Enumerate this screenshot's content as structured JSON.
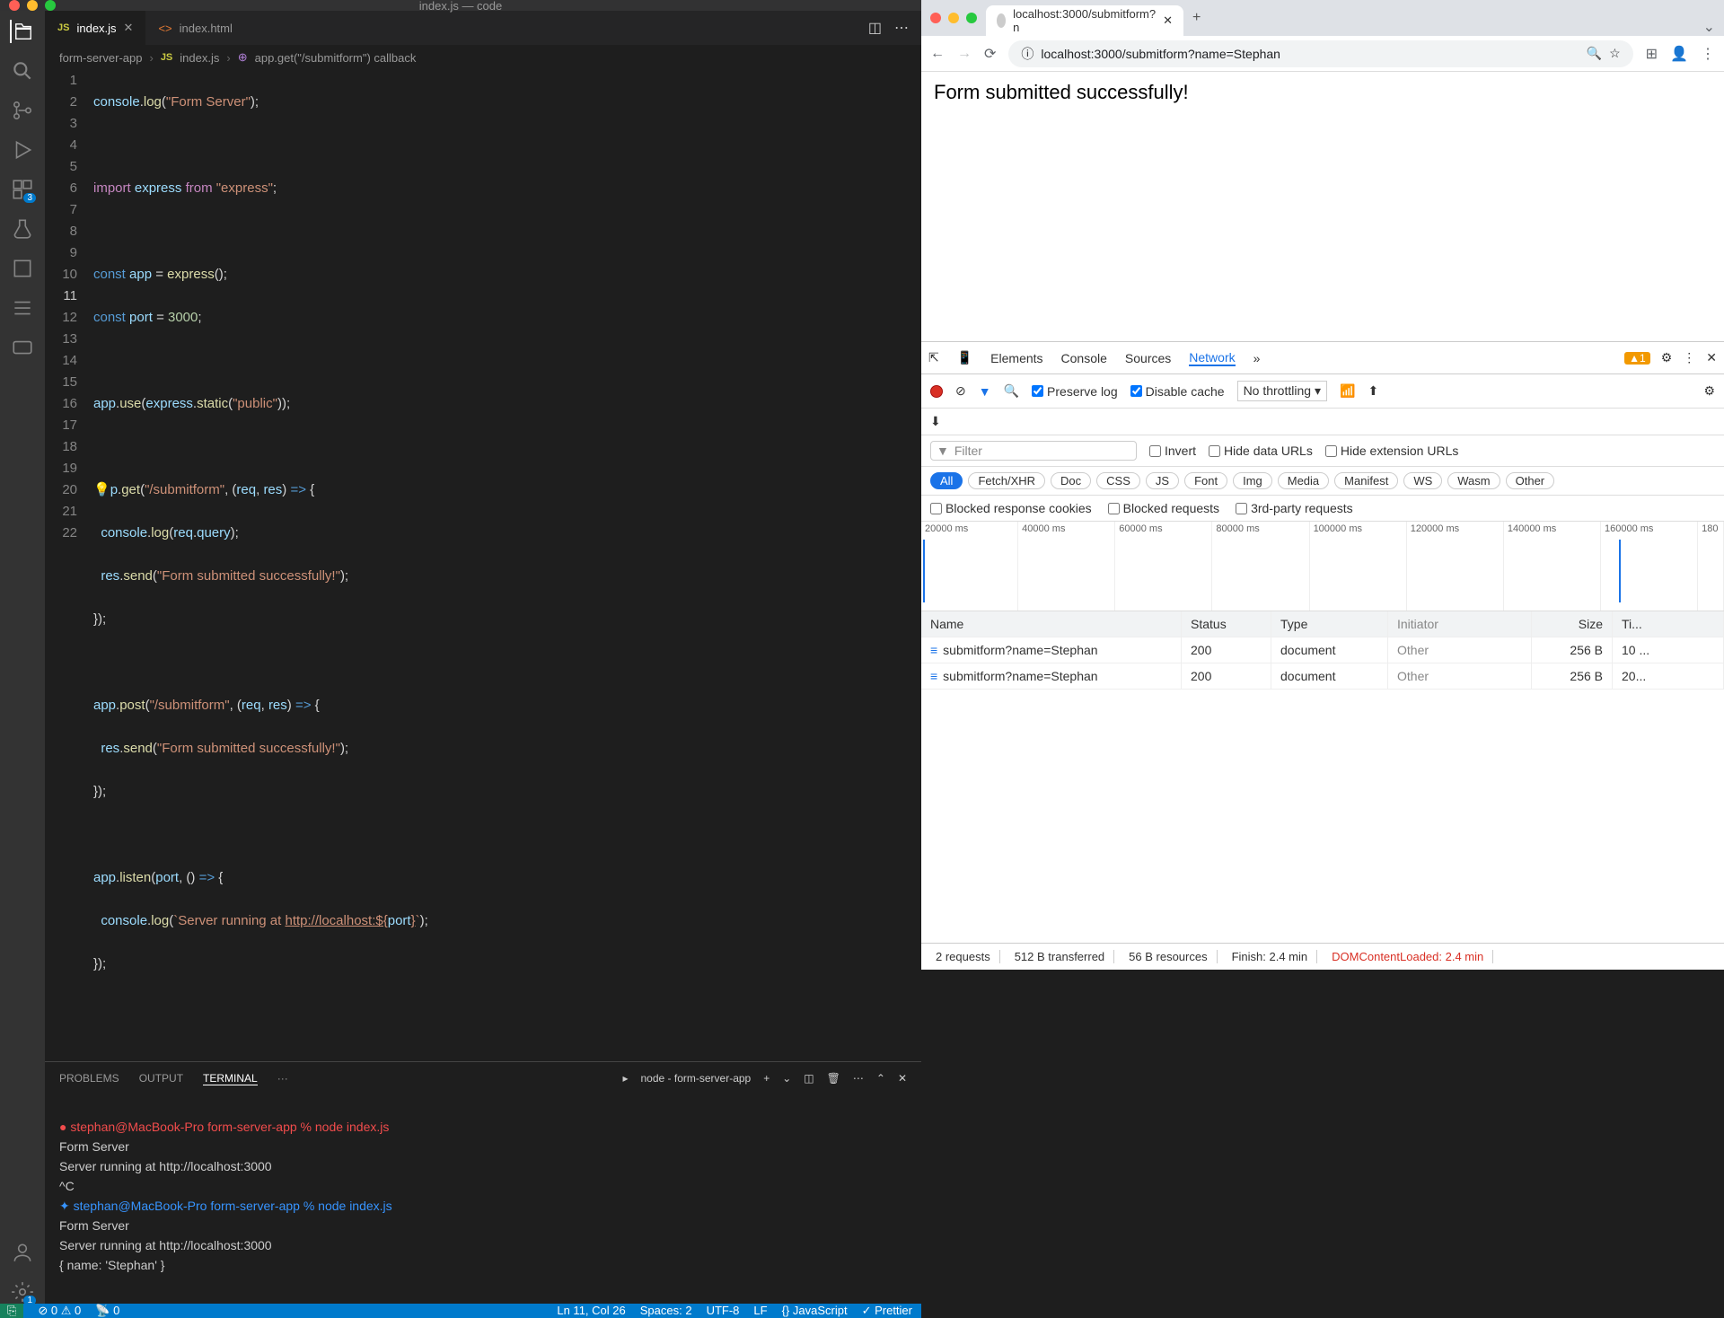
{
  "vscode": {
    "title": "index.js — code",
    "tabs": [
      {
        "label": "index.js",
        "icon": "JS",
        "active": true
      },
      {
        "label": "index.html",
        "icon": "<>",
        "active": false
      }
    ],
    "breadcrumb": [
      "form-server-app",
      "index.js",
      "app.get(\"/submitform\") callback"
    ],
    "activity_badges": {
      "extensions": "3",
      "settings": "1"
    },
    "code_lines": 22,
    "current_line": 11,
    "panel": {
      "tabs": [
        "PROBLEMS",
        "OUTPUT",
        "TERMINAL",
        "···"
      ],
      "active": "TERMINAL",
      "process": "node - form-server-app",
      "terminal": [
        {
          "type": "err",
          "text": "● stephan@MacBook-Pro form-server-app % node index.js"
        },
        {
          "type": "out",
          "text": "Form Server"
        },
        {
          "type": "out",
          "text": "Server running at http://localhost:3000"
        },
        {
          "type": "out",
          "text": "^C"
        },
        {
          "type": "ok",
          "text": "✦ stephan@MacBook-Pro form-server-app % node index.js"
        },
        {
          "type": "out",
          "text": "Form Server"
        },
        {
          "type": "out",
          "text": "Server running at http://localhost:3000"
        },
        {
          "type": "out",
          "text": "{ name: 'Stephan' }"
        }
      ]
    },
    "status": {
      "errors": "0",
      "warnings": "0",
      "ports": "0",
      "cursor": "Ln 11, Col 26",
      "spaces": "Spaces: 2",
      "enc": "UTF-8",
      "eol": "LF",
      "lang": "JavaScript",
      "prettier": "Prettier"
    }
  },
  "chrome": {
    "tab_title": "localhost:3000/submitform?n",
    "url": "localhost:3000/submitform?name=Stephan",
    "page_text": "Form submitted successfully!",
    "devtools": {
      "tabs": [
        "Elements",
        "Console",
        "Sources",
        "Network"
      ],
      "active": "Network",
      "warnings": "1",
      "preserve_log": "Preserve log",
      "disable_cache": "Disable cache",
      "throttling": "No throttling",
      "filter_placeholder": "Filter",
      "filter_opts": [
        "Invert",
        "Hide data URLs",
        "Hide extension URLs"
      ],
      "type_chips": [
        "All",
        "Fetch/XHR",
        "Doc",
        "CSS",
        "JS",
        "Font",
        "Img",
        "Media",
        "Manifest",
        "WS",
        "Wasm",
        "Other"
      ],
      "blocked": [
        "Blocked response cookies",
        "Blocked requests",
        "3rd-party requests"
      ],
      "timeline_ticks": [
        "20000 ms",
        "40000 ms",
        "60000 ms",
        "80000 ms",
        "100000 ms",
        "120000 ms",
        "140000 ms",
        "160000 ms",
        "180"
      ],
      "table_headers": [
        "Name",
        "Status",
        "Type",
        "Initiator",
        "Size",
        "Ti..."
      ],
      "requests": [
        {
          "name": "submitform?name=Stephan",
          "status": "200",
          "type": "document",
          "initiator": "Other",
          "size": "256 B",
          "time": "10 ..."
        },
        {
          "name": "submitform?name=Stephan",
          "status": "200",
          "type": "document",
          "initiator": "Other",
          "size": "256 B",
          "time": "20..."
        }
      ],
      "status": {
        "count": "2 requests",
        "transferred": "512 B transferred",
        "resources": "56 B resources",
        "finish": "Finish: 2.4 min",
        "dom": "DOMContentLoaded: 2.4 min"
      }
    }
  }
}
